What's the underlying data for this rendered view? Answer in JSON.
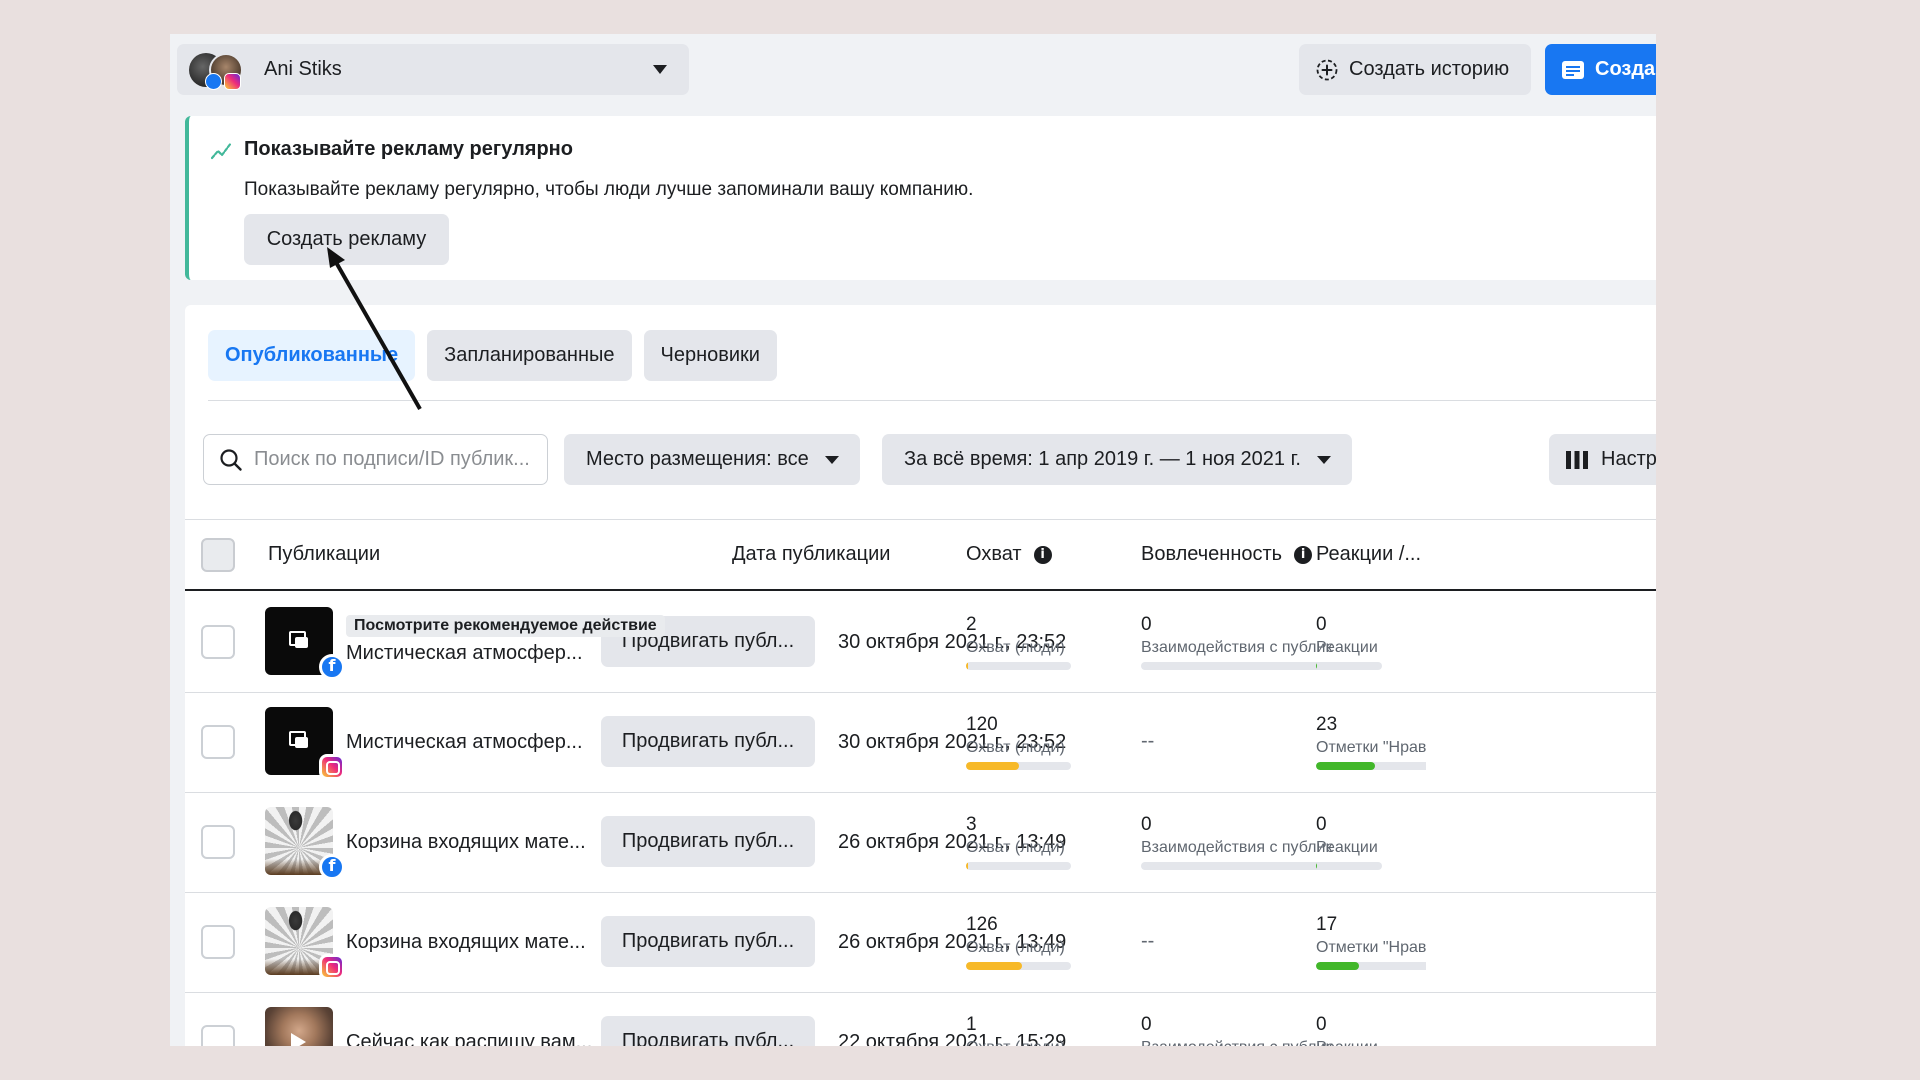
{
  "account": {
    "name": "Ani Stiks"
  },
  "header": {
    "story_button": "Создать историю",
    "create_button": "Созда"
  },
  "banner": {
    "title": "Показывайте рекламу регулярно",
    "body": "Показывайте рекламу регулярно, чтобы люди лучше запоминали вашу компанию.",
    "button": "Создать рекламу"
  },
  "tabs": [
    {
      "label": "Опубликованные",
      "active": true
    },
    {
      "label": "Запланированные",
      "active": false
    },
    {
      "label": "Черновики",
      "active": false
    }
  ],
  "filters": {
    "search_placeholder": "Поиск по подписи/ID публик...",
    "placement": "Место размещения: все",
    "date_range": "За всё время: 1 апр 2019 г. — 1 ноя 2021 г.",
    "columns": "Настр"
  },
  "table": {
    "headers": {
      "posts": "Публикации",
      "date": "Дата публикации",
      "reach": "Охват",
      "engagement": "Вовлеченность",
      "reactions": "Реакции /..."
    },
    "hint": "Посмотрите рекомендуемое действие",
    "promote_label": "Продвигать публ...",
    "rows": [
      {
        "title": "Мистическая атмосфер...",
        "platform": "facebook",
        "thumb": "black",
        "date": "30 октября 2021 г., 23:52",
        "reach": "2",
        "reach_label": "Охват (люди)",
        "reach_fill": 0.02,
        "engagement": "0",
        "engagement_label": "Взаимодействия с публикацией",
        "engagement_fill": 0,
        "reactions": "0",
        "reactions_label": "Реакции",
        "reactions_fill": 0
      },
      {
        "title": "Мистическая атмосфер...",
        "platform": "instagram",
        "thumb": "black",
        "date": "30 октября 2021 г., 23:52",
        "reach": "120",
        "reach_label": "Охват (люди)",
        "reach_fill": 0.5,
        "engagement": "--",
        "engagement_label": "",
        "engagement_fill": null,
        "reactions": "23",
        "reactions_label": "Отметки \"Нравится\"",
        "reactions_fill": 0.45
      },
      {
        "title": "Корзина входящих мате...",
        "platform": "facebook",
        "thumb": "photo",
        "date": "26 октября 2021 г., 13:49",
        "reach": "3",
        "reach_label": "Охват (люди)",
        "reach_fill": 0.02,
        "engagement": "0",
        "engagement_label": "Взаимодействия с публикацией",
        "engagement_fill": 0,
        "reactions": "0",
        "reactions_label": "Реакции",
        "reactions_fill": 0
      },
      {
        "title": "Корзина входящих мате...",
        "platform": "instagram",
        "thumb": "photo",
        "date": "26 октября 2021 г., 13:49",
        "reach": "126",
        "reach_label": "Охват (люди)",
        "reach_fill": 0.53,
        "engagement": "--",
        "engagement_label": "",
        "engagement_fill": null,
        "reactions": "17",
        "reactions_label": "Отметки \"Нравится\"",
        "reactions_fill": 0.33
      },
      {
        "title": "Сейчас как распишу вам...",
        "platform": "facebook",
        "thumb": "person",
        "date": "22 октября 2021 г., 15:29",
        "reach": "1",
        "reach_label": "Охват (люди)",
        "reach_fill": 0.01,
        "engagement": "0",
        "engagement_label": "Взаимодействия с публикацией",
        "engagement_fill": 0,
        "reactions": "0",
        "reactions_label": "Реакции",
        "reactions_fill": 0
      }
    ]
  },
  "colors": {
    "primary": "#1877f2",
    "reach_bar": "#f7b928",
    "reactions_bar": "#42b72a",
    "banner_accent": "#42b89a"
  }
}
